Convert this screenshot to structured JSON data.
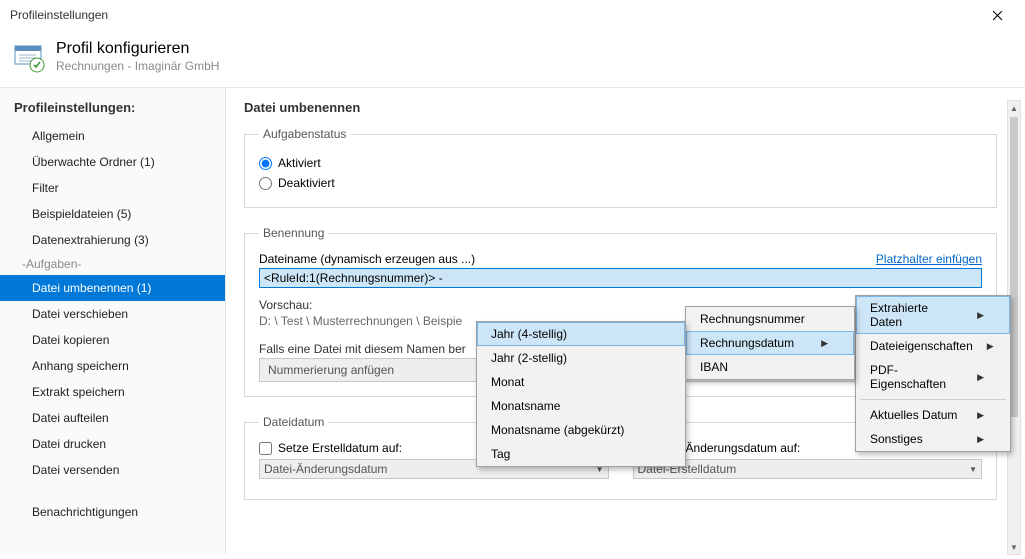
{
  "window": {
    "title": "Profileinstellungen"
  },
  "header": {
    "title": "Profil konfigurieren",
    "subtitle": "Rechnungen - Imaginär GmbH"
  },
  "sidebar": {
    "heading": "Profileinstellungen:",
    "items": [
      "Allgemein",
      "Überwachte Ordner (1)",
      "Filter",
      "Beispieldateien (5)",
      "Datenextrahierung (3)"
    ],
    "group": "-Aufgaben-",
    "tasks": [
      "Datei umbenennen (1)",
      "Datei verschieben",
      "Datei kopieren",
      "Anhang speichern",
      "Extrakt speichern",
      "Datei aufteilen",
      "Datei drucken",
      "Datei versenden"
    ],
    "notifications": "Benachrichtigungen"
  },
  "content": {
    "heading": "Datei umbenennen",
    "status": {
      "legend": "Aufgabenstatus",
      "opt_active": "Aktiviert",
      "opt_inactive": "Deaktiviert"
    },
    "naming": {
      "legend": "Benennung",
      "filename_label": "Dateiname (dynamisch erzeugen aus ...)",
      "placeholder_link": "Platzhalter einfügen",
      "filename_value": "<RuleId:1(Rechnungsnummer)> -",
      "preview_label": "Vorschau:",
      "preview_path": "D: \\ Test \\ Musterrechnungen \\ Beispie",
      "exists_label": "Falls eine Datei mit diesem Namen ber",
      "exists_action": "Nummerierung anfügen"
    },
    "filedate": {
      "legend": "Dateidatum",
      "set_created": "Setze Erstelldatum auf:",
      "set_modified": "Setze Änderungsdatum auf:",
      "created_select": "Datei-Änderungsdatum",
      "modified_select": "Datei-Erstelldatum"
    }
  },
  "menus": {
    "m1": {
      "items": [
        "Extrahierte Daten",
        "Dateieigenschaften",
        "PDF-Eigenschaften"
      ],
      "extra": [
        "Aktuelles Datum",
        "Sonstiges"
      ]
    },
    "m2": {
      "items": [
        "Rechnungsnummer",
        "Rechnungsdatum",
        "IBAN"
      ]
    },
    "m3": {
      "items": [
        "Jahr (4-stellig)",
        "Jahr (2-stellig)",
        "Monat",
        "Monatsname",
        "Monatsname (abgekürzt)",
        "Tag"
      ]
    }
  }
}
